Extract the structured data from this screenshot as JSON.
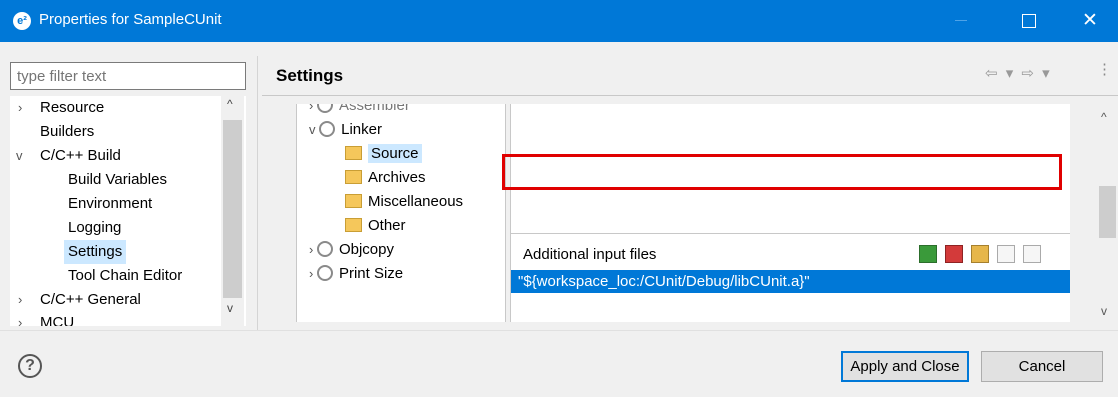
{
  "window": {
    "title": "Properties for SampleCUnit",
    "icon_name": "eclipse-e2-icon",
    "accent": "#0078d7"
  },
  "filter": {
    "placeholder": "type filter text"
  },
  "left_tree": [
    {
      "label": "Resource",
      "expander": ">"
    },
    {
      "label": "Builders",
      "expander": ""
    },
    {
      "label": "C/C++ Build",
      "expander": "v"
    },
    {
      "label": "Build Variables",
      "expander": ""
    },
    {
      "label": "Environment",
      "expander": ""
    },
    {
      "label": "Logging",
      "expander": ""
    },
    {
      "label": "Settings",
      "expander": "",
      "selected": true
    },
    {
      "label": "Tool Chain Editor",
      "expander": ""
    },
    {
      "label": "C/C++ General",
      "expander": ">"
    },
    {
      "label": "MCU",
      "expander": ">"
    }
  ],
  "page_title": "Settings",
  "tool_tree": [
    {
      "label": "Assembler",
      "expander": ">"
    },
    {
      "label": "Linker",
      "expander": "v"
    },
    {
      "label": "Source",
      "selected": true
    },
    {
      "label": "Archives"
    },
    {
      "label": "Miscellaneous"
    },
    {
      "label": "Other"
    },
    {
      "label": "Objcopy",
      "expander": ">"
    },
    {
      "label": "Print Size",
      "expander": ">"
    }
  ],
  "additional_input_files": {
    "label": "Additional input files",
    "entries": [
      "\"${workspace_loc:/CUnit/Debug/libCUnit.a}\""
    ],
    "selected_index": 0,
    "toolbar_icons": [
      "add-icon",
      "delete-icon",
      "edit-icon",
      "move-up-icon",
      "move-down-icon"
    ]
  },
  "buttons": {
    "apply_close": "Apply and Close",
    "cancel": "Cancel"
  },
  "highlight_color": "#e00000"
}
